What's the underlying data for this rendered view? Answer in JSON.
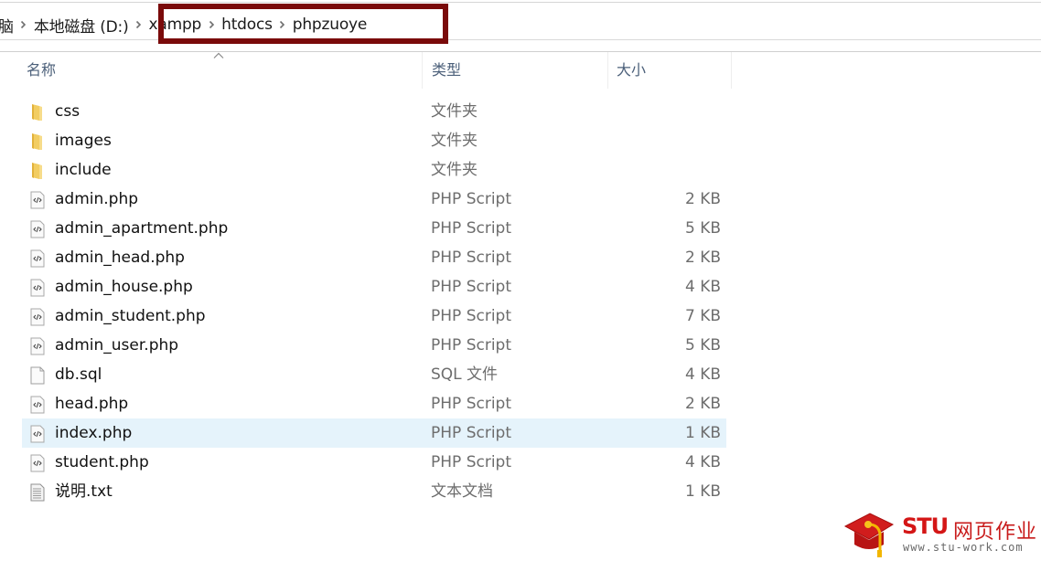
{
  "address_bar": {
    "crumbs": [
      "脑",
      "本地磁盘 (D:)",
      "xampp",
      "htdocs",
      "phpzuoye"
    ],
    "highlight_color": "#7a0a0a"
  },
  "columns": {
    "name": "名称",
    "type": "类型",
    "size": "大小",
    "sort_indicator": "ascending"
  },
  "files": [
    {
      "name": "css",
      "type": "文件夹",
      "size": "",
      "icon": "folder-icon"
    },
    {
      "name": "images",
      "type": "文件夹",
      "size": "",
      "icon": "folder-icon"
    },
    {
      "name": "include",
      "type": "文件夹",
      "size": "",
      "icon": "folder-icon"
    },
    {
      "name": "admin.php",
      "type": "PHP Script",
      "size": "2 KB",
      "icon": "php-file-icon"
    },
    {
      "name": "admin_apartment.php",
      "type": "PHP Script",
      "size": "5 KB",
      "icon": "php-file-icon"
    },
    {
      "name": "admin_head.php",
      "type": "PHP Script",
      "size": "2 KB",
      "icon": "php-file-icon"
    },
    {
      "name": "admin_house.php",
      "type": "PHP Script",
      "size": "4 KB",
      "icon": "php-file-icon"
    },
    {
      "name": "admin_student.php",
      "type": "PHP Script",
      "size": "7 KB",
      "icon": "php-file-icon"
    },
    {
      "name": "admin_user.php",
      "type": "PHP Script",
      "size": "5 KB",
      "icon": "php-file-icon"
    },
    {
      "name": "db.sql",
      "type": "SQL 文件",
      "size": "4 KB",
      "icon": "blank-file-icon"
    },
    {
      "name": "head.php",
      "type": "PHP Script",
      "size": "2 KB",
      "icon": "php-file-icon"
    },
    {
      "name": "index.php",
      "type": "PHP Script",
      "size": "1 KB",
      "icon": "php-file-icon",
      "selected": true
    },
    {
      "name": "student.php",
      "type": "PHP Script",
      "size": "4 KB",
      "icon": "php-file-icon"
    },
    {
      "name": "说明.txt",
      "type": "文本文档",
      "size": "1 KB",
      "icon": "text-file-icon"
    }
  ],
  "watermark": {
    "brand": "STU",
    "brand_cn": "网页作业",
    "url": "www.stu-work.com"
  },
  "colors": {
    "selected_row": "#e5f3fb",
    "header_text": "#4c607a",
    "brand_red": "#d41616"
  }
}
